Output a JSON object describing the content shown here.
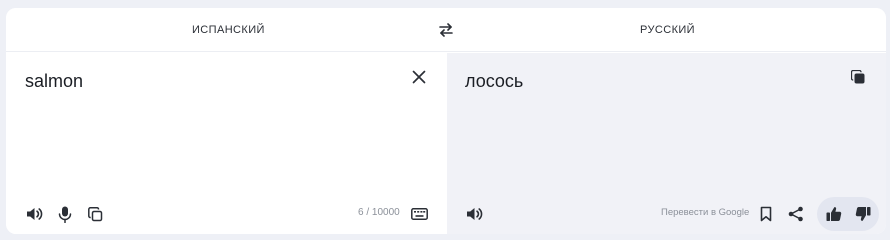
{
  "header": {
    "source_lang": "ИСПАНСКИЙ",
    "target_lang": "РУССКИЙ",
    "swap_icon": "swap-arrows-icon"
  },
  "source": {
    "text": "salmon",
    "char_count": "6 / 10000",
    "icons": [
      "close-icon",
      "speaker-icon",
      "microphone-icon",
      "copy-icon",
      "keyboard-icon"
    ]
  },
  "target": {
    "text": "лосось",
    "google_link": "Перевести в Google",
    "icons": [
      "copy-icon",
      "speaker-icon",
      "bookmark-icon",
      "share-icon",
      "thumbs-up-icon",
      "thumbs-down-icon"
    ]
  },
  "colors": {
    "page_bg": "#eef0f6",
    "target_bg": "#f1f2f7",
    "icon": "#2b2f36",
    "muted_text": "#8b9099"
  }
}
